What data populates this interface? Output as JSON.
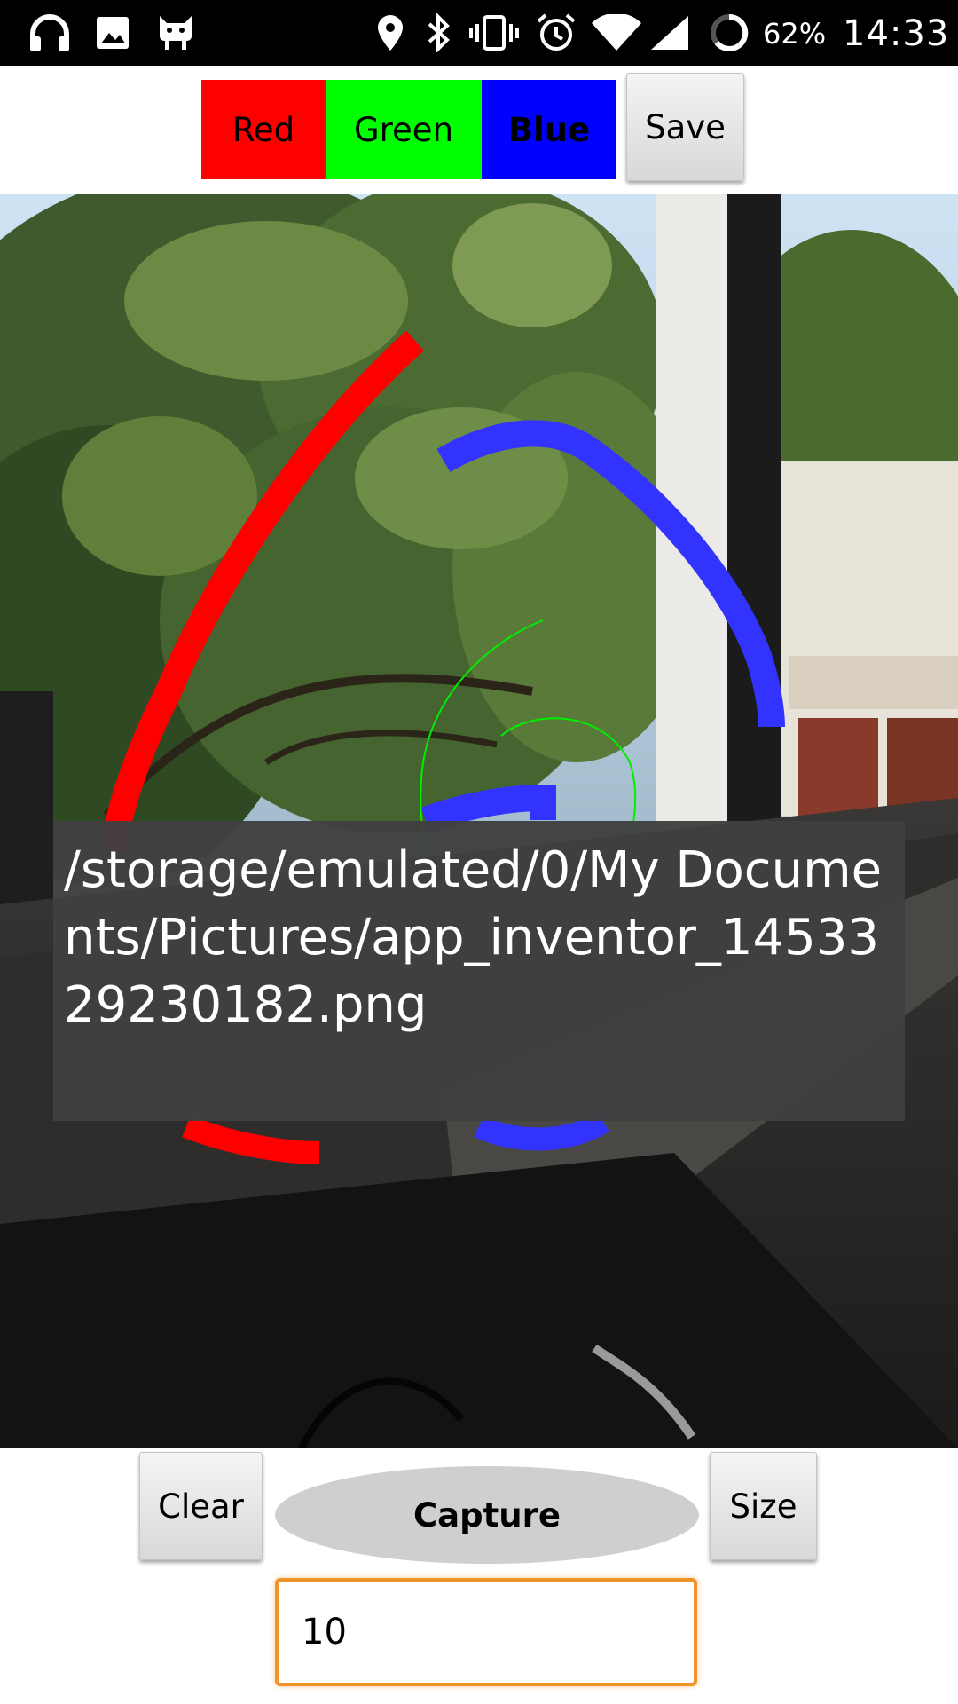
{
  "status_bar": {
    "icons": [
      "headphones-icon",
      "image-icon",
      "android-icon",
      "location-icon",
      "bluetooth-icon",
      "vibrate-icon",
      "alarm-icon",
      "wifi-icon",
      "signal-icon",
      "battery-ring-icon"
    ],
    "battery": "62%",
    "time": "14:33"
  },
  "toolbar": {
    "red_label": "Red",
    "green_label": "Green",
    "blue_label": "Blue",
    "save_label": "Save",
    "colors": {
      "red": "#ff0000",
      "green": "#00ff00",
      "blue": "#0000ff"
    }
  },
  "canvas": {
    "background": "photo of trees seen through a window",
    "stroke_colors": {
      "red": "#ff0000",
      "green": "#00ff00",
      "blue": "#3333ff"
    }
  },
  "toast": {
    "message": "/storage/emulated/0/My Documents/Pictures/app_inventor_1453329230182.png"
  },
  "controls": {
    "clear_label": "Clear",
    "capture_label": "Capture",
    "size_label": "Size",
    "size_value": "10"
  }
}
